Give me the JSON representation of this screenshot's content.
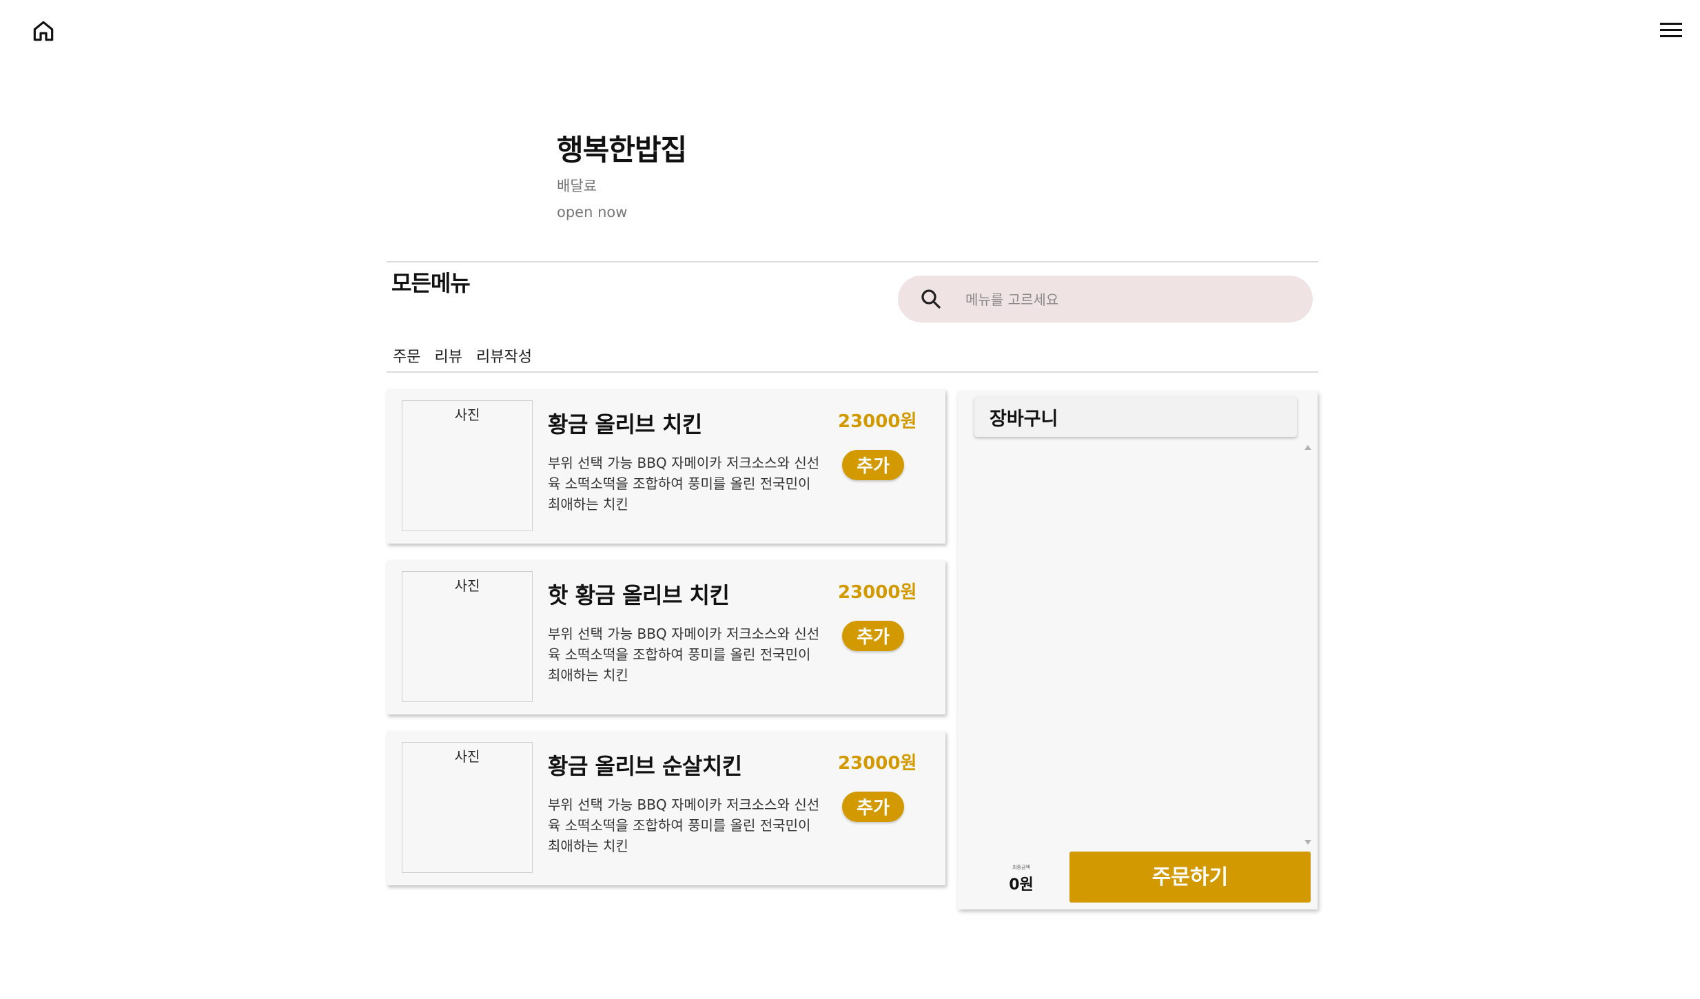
{
  "nav": {
    "home_icon": "home-icon",
    "menu_icon": "hamburger-menu-icon"
  },
  "store": {
    "name": "행복한밥집",
    "delivery_fee_label": "배달료",
    "status": "open now"
  },
  "section": {
    "title": "모든메뉴"
  },
  "search": {
    "placeholder": "메뉴를 고르세요",
    "icon": "search-icon"
  },
  "tabs": [
    {
      "label": "주문"
    },
    {
      "label": "리뷰"
    },
    {
      "label": "리뷰작성"
    }
  ],
  "menu_items": [
    {
      "photo_label": "사진",
      "name": "황금 올리브 치킨",
      "description": "부위 선택 가능 BBQ 자메이카 저크소스와 신선육 소떡소떡을 조합하여 풍미를 올린 전국민이 최애하는 치킨",
      "price": "23000원",
      "add_label": "추가"
    },
    {
      "photo_label": "사진",
      "name": "핫 황금 올리브 치킨",
      "description": "부위 선택 가능 BBQ 자메이카 저크소스와 신선육 소떡소떡을 조합하여 풍미를 올린 전국민이 최애하는 치킨",
      "price": "23000원",
      "add_label": "추가"
    },
    {
      "photo_label": "사진",
      "name": "황금 올리브 순살치킨",
      "description": "부위 선택 가능 BBQ 자메이카 저크소스와 신선육 소떡소떡을 조합하여 풍미를 올린 전국민이 최애하는 치킨",
      "price": "23000원",
      "add_label": "추가"
    }
  ],
  "cart": {
    "title": "장바구니",
    "total_label": "최종금액",
    "total_value": "0원",
    "order_label": "주문하기"
  },
  "colors": {
    "accent": "#d29a00",
    "search_bg": "#efe3e3",
    "card_bg": "#f7f7f7"
  }
}
